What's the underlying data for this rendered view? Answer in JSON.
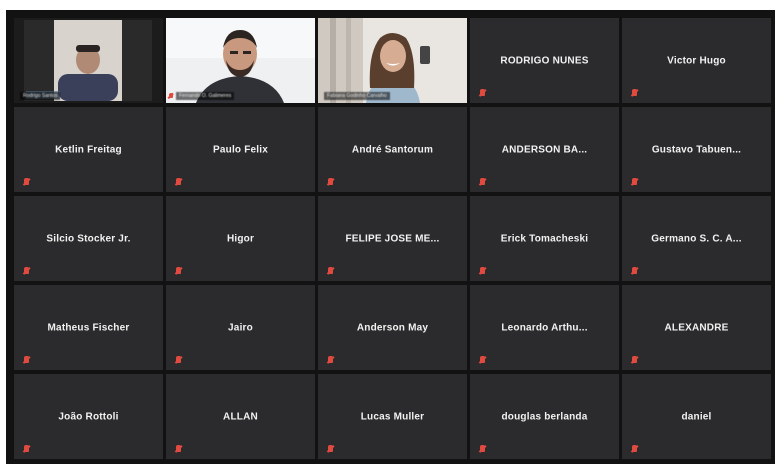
{
  "meeting": {
    "accent_active": "#b9c46a",
    "tile_bg": "#2b2b2d",
    "muted_color": "#e04a3f"
  },
  "video_tiles": [
    {
      "caption": "Rodrigo Santos",
      "active": true,
      "muted": false
    },
    {
      "caption": "Fernando O. Galimeres",
      "active": false,
      "muted": true
    },
    {
      "caption": "Fabiana Godinho Carvalho",
      "active": false,
      "muted": false
    }
  ],
  "participants": [
    "RODRIGO NUNES",
    "Victor Hugo",
    "Ketlin Freitag",
    "Paulo Felix",
    "André Santorum",
    "ANDERSON  BA...",
    "Gustavo  Tabuen...",
    "Silcio Stocker Jr.",
    "Higor",
    "FELIPE JOSE ME...",
    "Erick Tomacheski",
    "Germano S. C. A...",
    "Matheus Fischer",
    "Jairo",
    "Anderson May",
    "Leonardo  Arthu...",
    "ALEXANDRE",
    "João Rottoli",
    "ALLAN",
    "Lucas Muller",
    "douglas berlanda",
    "daniel"
  ]
}
